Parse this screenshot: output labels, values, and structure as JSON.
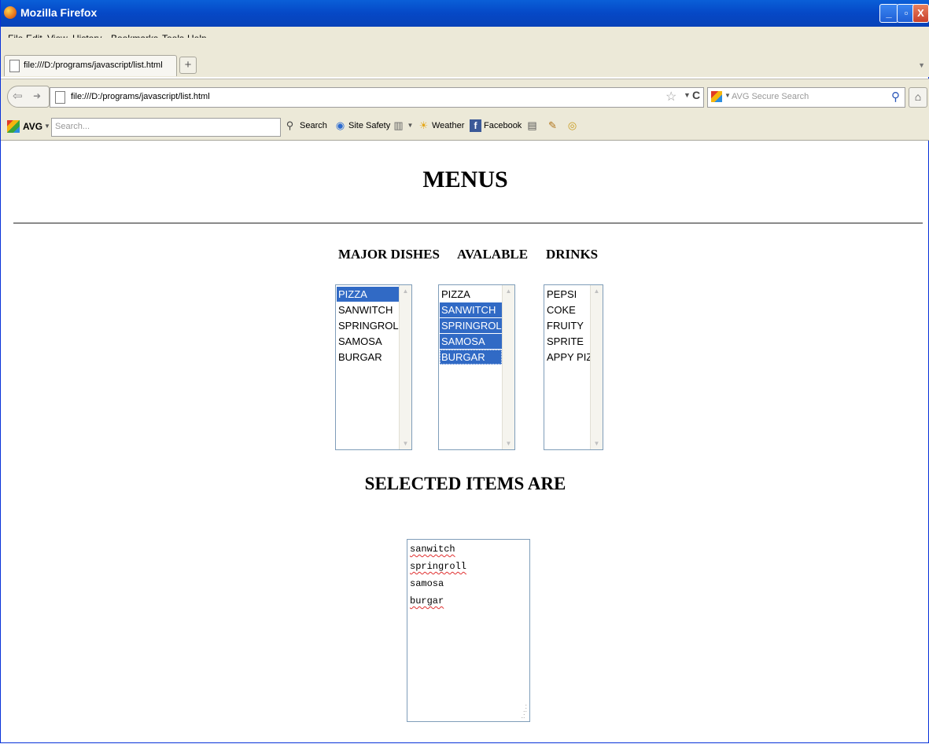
{
  "window": {
    "title": "Mozilla Firefox"
  },
  "menubar": {
    "items": [
      "File",
      "Edit",
      "View",
      "History",
      "Bookmarks",
      "Tools",
      "Help"
    ]
  },
  "tabs": [
    {
      "label": "file:///D:/programs/javascript/list.html"
    }
  ],
  "navbar": {
    "url": "file:///D:/programs/javascript/list.html",
    "search_placeholder": "AVG Secure Search"
  },
  "avg_toolbar": {
    "brand": "AVG",
    "search_placeholder": "Search...",
    "search_label": "Search",
    "site_safety_label": "Site Safety",
    "weather_label": "Weather",
    "facebook_label": "Facebook"
  },
  "page": {
    "heading": "MENUS",
    "lists": [
      {
        "title": "MAJOR DISHES",
        "options": [
          "PIZZA",
          "SANWITCH",
          "SPRINGROLL",
          "SAMOSA",
          "BURGAR"
        ],
        "selected": [
          0
        ],
        "focused": null
      },
      {
        "title": "AVALABLE",
        "options": [
          "PIZZA",
          "SANWITCH",
          "SPRINGROLL",
          "SAMOSA",
          "BURGAR"
        ],
        "selected": [
          1,
          2,
          3,
          4
        ],
        "focused": 4
      },
      {
        "title": "DRINKS",
        "options": [
          "PEPSI",
          "COKE",
          "FRUITY",
          "SPRITE",
          "APPY PIZ"
        ],
        "selected": [],
        "focused": null
      }
    ],
    "selected_heading": "SELECTED ITEMS ARE",
    "selected_items": [
      "sanwitch",
      "springroll",
      "samosa",
      "burgar"
    ],
    "spellcheck_flagged": [
      0,
      1,
      3
    ]
  }
}
